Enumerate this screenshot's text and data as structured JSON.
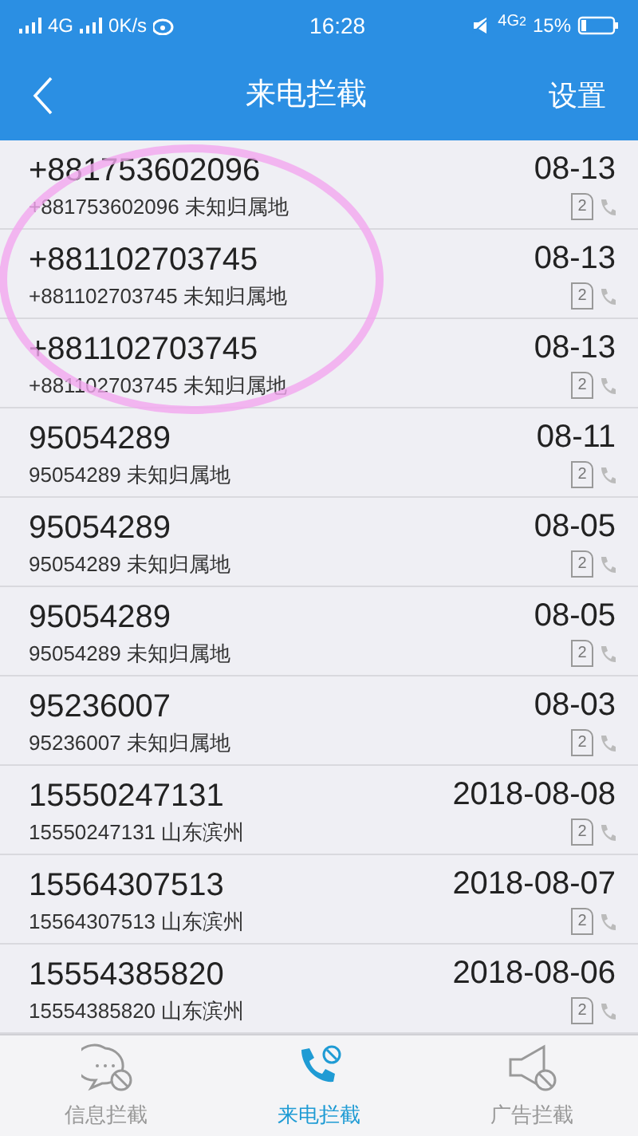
{
  "status_bar": {
    "network": "4G",
    "speed": "0K/s",
    "time": "16:28",
    "network_2": "4G",
    "sim": "2",
    "battery": "15%"
  },
  "header": {
    "title": "来电拦截",
    "action": "设置"
  },
  "calls": [
    {
      "number": "+881753602096",
      "detail": "+881753602096 未知归属地",
      "date": "08-13",
      "sim": "2"
    },
    {
      "number": "+881102703745",
      "detail": "+881102703745 未知归属地",
      "date": "08-13",
      "sim": "2"
    },
    {
      "number": "+881102703745",
      "detail": "+881102703745 未知归属地",
      "date": "08-13",
      "sim": "2"
    },
    {
      "number": "95054289",
      "detail": "95054289 未知归属地",
      "date": "08-11",
      "sim": "2"
    },
    {
      "number": "95054289",
      "detail": "95054289 未知归属地",
      "date": "08-05",
      "sim": "2"
    },
    {
      "number": "95054289",
      "detail": "95054289 未知归属地",
      "date": "08-05",
      "sim": "2"
    },
    {
      "number": "95236007",
      "detail": "95236007 未知归属地",
      "date": "08-03",
      "sim": "2"
    },
    {
      "number": "15550247131",
      "detail": "15550247131 山东滨州",
      "date": "2018-08-08",
      "sim": "2"
    },
    {
      "number": "15564307513",
      "detail": "15564307513 山东滨州",
      "date": "2018-08-07",
      "sim": "2"
    },
    {
      "number": "15554385820",
      "detail": "15554385820 山东滨州",
      "date": "2018-08-06",
      "sim": "2"
    }
  ],
  "annotation": {
    "kind": "circle"
  },
  "tabs": [
    {
      "label": "信息拦截",
      "kind": "message",
      "selected": false
    },
    {
      "label": "来电拦截",
      "kind": "call",
      "selected": true
    },
    {
      "label": "广告拦截",
      "kind": "ad",
      "selected": false
    }
  ]
}
